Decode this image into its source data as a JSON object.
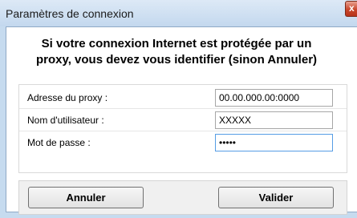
{
  "window": {
    "title": "Paramètres de connexion",
    "close_symbol": "x"
  },
  "message": {
    "line1": "Si votre connexion Internet est protégée par un",
    "line2": "proxy, vous devez vous identifier (sinon Annuler)"
  },
  "form": {
    "proxy": {
      "label": "Adresse du proxy :",
      "value": "00.00.000.00:0000"
    },
    "username": {
      "label": "Nom d'utilisateur :",
      "value": "XXXXX"
    },
    "password": {
      "label": "Mot de passe :",
      "value": "•••••"
    }
  },
  "buttons": {
    "cancel_label": "Annuler",
    "ok_label": "Valider"
  }
}
